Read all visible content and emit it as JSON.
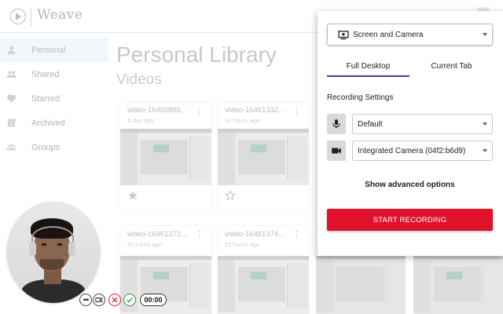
{
  "app": {
    "logo_text": "Weave"
  },
  "sidebar": {
    "items": [
      {
        "label": "Personal",
        "icon": "person-icon"
      },
      {
        "label": "Shared",
        "icon": "people-icon"
      },
      {
        "label": "Starred",
        "icon": "heart-icon"
      },
      {
        "label": "Archived",
        "icon": "archive-icon"
      },
      {
        "label": "Groups",
        "icon": "groups-icon"
      }
    ],
    "active_index": 0
  },
  "library": {
    "title": "Personal Library",
    "subtitle": "Videos",
    "cards": [
      {
        "title": "video-16460885...",
        "date": "1 day ago",
        "starred": true
      },
      {
        "title": "video-16461332...",
        "date": "24 hours ago",
        "starred": false
      },
      {
        "title": "video-16461372...",
        "date": "22 hours ago"
      },
      {
        "title": "video-16461374...",
        "date": "22 hours ago"
      }
    ]
  },
  "popup": {
    "mode": "Screen and Camera",
    "mode_icon": "screen-camera-icon",
    "tabs": [
      {
        "label": "Full Desktop",
        "active": true
      },
      {
        "label": "Current Tab",
        "active": false
      }
    ],
    "settings_label": "Recording Settings",
    "microphone": "Default",
    "camera": "Integrated Camera (04f2:b6d9)",
    "advanced_label": "Show advanced options",
    "start_label": "START RECORDING",
    "accent_color": "#e0112a",
    "tab_underline_color": "#5b2ea6"
  },
  "controls": {
    "timer": "00:00"
  }
}
